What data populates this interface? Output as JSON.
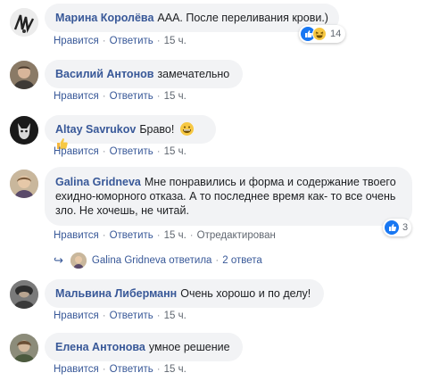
{
  "comments": [
    {
      "author": "Марина Королёва",
      "text": "ААА. После переливания крови.)",
      "like": "Нравится",
      "reply": "Ответить",
      "time": "15 ч.",
      "reactions": {
        "count": "14",
        "icons": [
          "like-icon",
          "haha-icon"
        ]
      }
    },
    {
      "author": "Василий Антонов",
      "text": "замечательно",
      "like": "Нравится",
      "reply": "Ответить",
      "time": "15 ч."
    },
    {
      "author": "Altay Savrukov",
      "text": "Браво!",
      "like": "Нравится",
      "reply": "Ответить",
      "time": "15 ч.",
      "emojis": [
        "grinning-face-icon",
        "thumbs-up-icon"
      ]
    },
    {
      "author": "Galina Gridneva",
      "text": "Мне понравились и форма и содержание твоего ехидно-юморного отказа. А то последнее время как- то все очень зло. Не хочешь, не читай.",
      "like": "Нравится",
      "reply": "Ответить",
      "time": "15 ч.",
      "edited": "Отредактирован",
      "reactions": {
        "count": "3",
        "icons": [
          "like-icon"
        ]
      },
      "replies": {
        "author": "Galina Gridneva",
        "verb": "ответила",
        "count_label": "2 ответа"
      }
    },
    {
      "author": "Мальвина Либерманн",
      "text": "Очень хорошо и по делу!",
      "like": "Нравится",
      "reply": "Ответить",
      "time": "15 ч."
    },
    {
      "author": "Елена Антонова",
      "text": "умное решение",
      "like": "Нравится",
      "reply": "Ответить",
      "time": "15 ч."
    }
  ],
  "colors": {
    "link": "#385898",
    "bubble": "#f2f3f5",
    "meta": "#606770",
    "like_blue": "#1877f2",
    "emoji_yellow": "#f7c843"
  }
}
